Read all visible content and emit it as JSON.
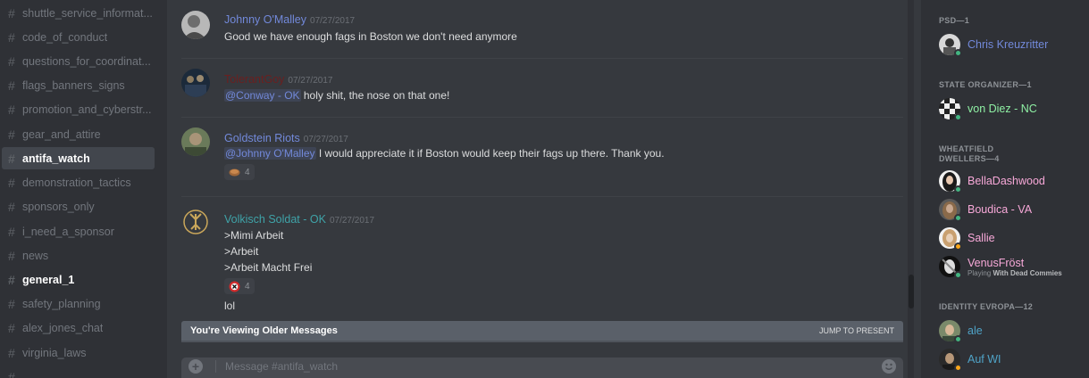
{
  "sidebar": {
    "channels": [
      {
        "name": "shuttle_service_informat...",
        "state": "normal"
      },
      {
        "name": "code_of_conduct",
        "state": "normal"
      },
      {
        "name": "questions_for_coordinat...",
        "state": "normal"
      },
      {
        "name": "flags_banners_signs",
        "state": "normal"
      },
      {
        "name": "promotion_and_cyberstr...",
        "state": "normal"
      },
      {
        "name": "gear_and_attire",
        "state": "normal"
      },
      {
        "name": "antifa_watch",
        "state": "active"
      },
      {
        "name": "demonstration_tactics",
        "state": "normal"
      },
      {
        "name": "sponsors_only",
        "state": "normal"
      },
      {
        "name": "i_need_a_sponsor",
        "state": "normal"
      },
      {
        "name": "news",
        "state": "normal"
      },
      {
        "name": "general_1",
        "state": "unread"
      },
      {
        "name": "safety_planning",
        "state": "normal"
      },
      {
        "name": "alex_jones_chat",
        "state": "normal"
      },
      {
        "name": "virginia_laws",
        "state": "normal"
      }
    ]
  },
  "chat": {
    "messages": [
      {
        "author": "Johnny O'Malley",
        "author_color": "#7289da",
        "timestamp": "07/27/2017",
        "lines": [
          {
            "text": "Good we have enough fags in Boston we don't need anymore"
          }
        ]
      },
      {
        "author": "TolerantGoy",
        "author_color": "#6b1f1f",
        "timestamp": "07/27/2017",
        "lines": [
          {
            "mention": "@Conway - OK",
            "text": " holy shit, the nose on that one!"
          }
        ]
      },
      {
        "author": "Goldstein Riots",
        "author_color": "#7289da",
        "timestamp": "07/27/2017",
        "lines": [
          {
            "mention": "@Johnny O'Malley",
            "text": " I would appreciate it if Boston would keep their fags up there.  Thank you."
          }
        ],
        "reaction": {
          "icon": "bread-emoji",
          "count": "4"
        }
      },
      {
        "author": "Volkisch Soldat - OK",
        "author_color": "#3fa3a8",
        "timestamp": "07/27/2017",
        "lines": [
          {
            "text": ">Mimi Arbeit"
          },
          {
            "text": ">Arbeit"
          },
          {
            "text": ">Arbeit Macht Frei"
          }
        ],
        "reaction": {
          "icon": "emblem-emoji",
          "count": "4"
        },
        "extra_line": "lol"
      }
    ],
    "older_banner": {
      "text": "You're Viewing Older Messages",
      "jump": "JUMP TO PRESENT"
    },
    "composer": {
      "placeholder": "Message #antifa_watch"
    }
  },
  "members": {
    "groups": [
      {
        "title": "PSD—1",
        "members": [
          {
            "name": "Chris Kreuzritter",
            "color": "#7289da",
            "status": "online"
          }
        ]
      },
      {
        "title": "STATE ORGANIZER—1",
        "members": [
          {
            "name": "von Diez - NC",
            "color": "#8ff0a4",
            "status": "online"
          }
        ]
      },
      {
        "title": "WHEATFIELD DWELLERS—4",
        "members": [
          {
            "name": "BellaDashwood",
            "color": "#f7a8d8",
            "status": "online"
          },
          {
            "name": "Boudica - VA",
            "color": "#f7a8d8",
            "status": "online"
          },
          {
            "name": "Sallie",
            "color": "#f7a8d8",
            "status": "idle"
          },
          {
            "name": "VenusFröst",
            "color": "#f7a8d8",
            "status": "online",
            "playing_prefix": "Playing ",
            "playing_game": "With Dead Commies"
          }
        ]
      },
      {
        "title": "IDENTITY EVROPA—12",
        "members": [
          {
            "name": "ale",
            "color": "#4fa3c7",
            "status": "online"
          },
          {
            "name": "Auf WI",
            "color": "#4fa3c7",
            "status": "idle"
          }
        ]
      }
    ],
    "status_colors": {
      "online": "#43b581",
      "idle": "#faa61a"
    }
  }
}
